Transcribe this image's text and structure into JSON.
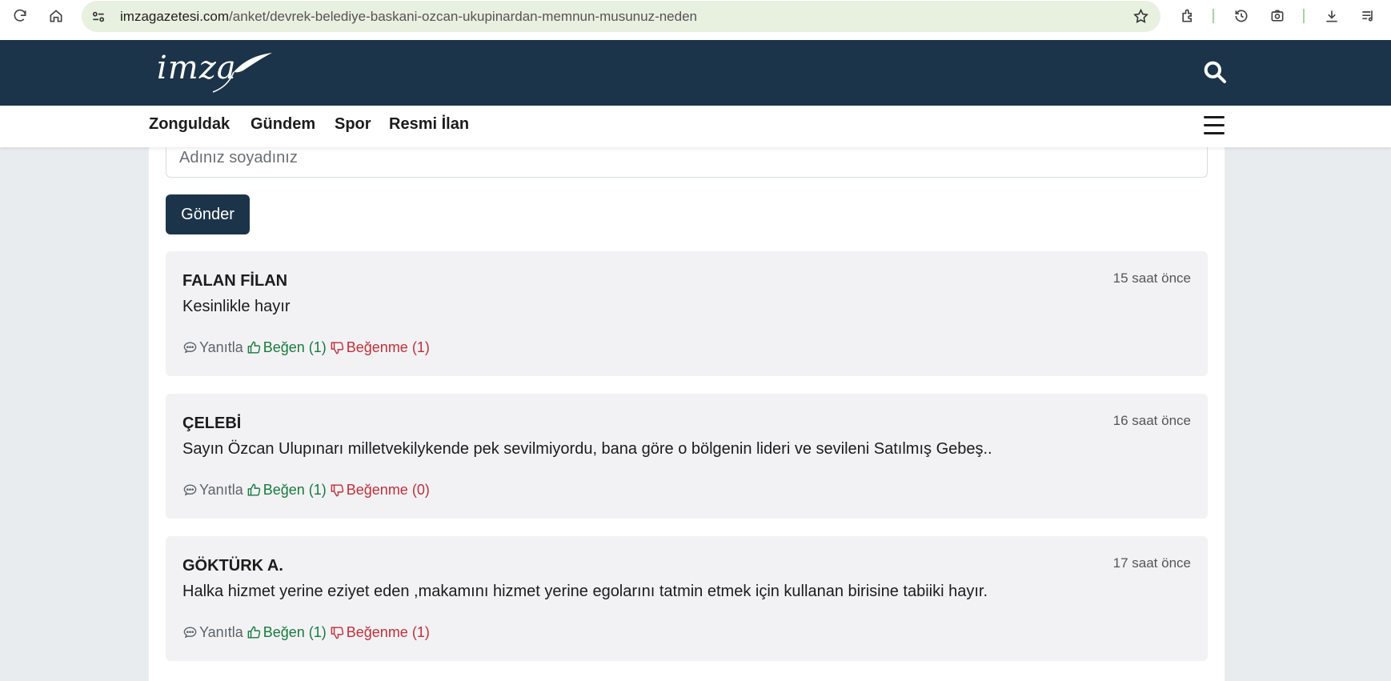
{
  "browser": {
    "url_domain": "imzagazetesi.com",
    "url_path": "/anket/devrek-belediye-baskani-ozcan-ukupinardan-memnun-musunuz-neden"
  },
  "site": {
    "logo_text": "imza"
  },
  "nav": {
    "items": [
      {
        "label": "Zonguldak"
      },
      {
        "label": "Gündem"
      },
      {
        "label": "Spor"
      },
      {
        "label": "Resmi İlan"
      }
    ]
  },
  "form": {
    "name_placeholder": "Adınız soyadınız",
    "submit_label": "Gönder"
  },
  "comments": [
    {
      "author": "FALAN FİLAN",
      "time": "15 saat önce",
      "text": "Kesinlikle hayır",
      "reply_label": "Yanıtla",
      "like_label": "Beğen (1)",
      "dislike_label": "Beğenme (1)"
    },
    {
      "author": "ÇELEBİ",
      "time": "16 saat önce",
      "text": "Sayın Özcan Ulupınarı milletvekilykende pek sevilmiyordu, bana göre o bölgenin lideri ve sevileni Satılmış Gebeş..",
      "reply_label": "Yanıtla",
      "like_label": "Beğen (1)",
      "dislike_label": "Beğenme (0)"
    },
    {
      "author": "GÖKTÜRK A.",
      "time": "17 saat önce",
      "text": "Halka hizmet yerine eziyet eden ,makamını hizmet yerine egolarını tatmin etmek için kullanan birisine tabiiki hayır.",
      "reply_label": "Yanıtla",
      "like_label": "Beğen (1)",
      "dislike_label": "Beğenme (1)"
    }
  ],
  "colors": {
    "header_bg": "#1c3449",
    "like": "#1a7a3f",
    "dislike": "#c0303a",
    "omnibox_bg": "#e8f0e0"
  }
}
